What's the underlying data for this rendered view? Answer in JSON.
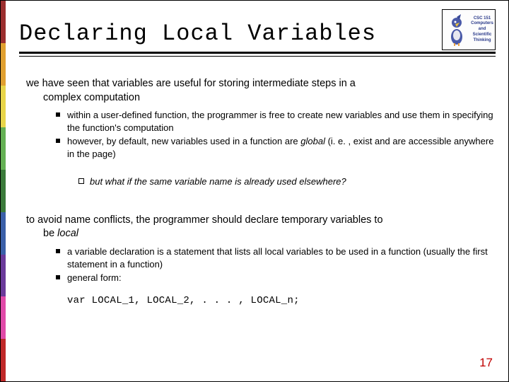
{
  "title": "Declaring Local Variables",
  "logo": {
    "course": "CSC 151",
    "line1": "Computers",
    "line2": "and",
    "line3": "Scientific",
    "line4": "Thinking"
  },
  "para1_a": "we have seen that variables are useful for storing intermediate steps in a",
  "para1_b": "complex computation",
  "bullets1": {
    "b1": "within a user-defined function, the programmer is free to create new variables and use them in specifying the function's computation",
    "b2_a": "however, by default, new variables used in a function are ",
    "b2_b": "global",
    "b2_c": " (i. e. , exist and are accessible anywhere in the page)"
  },
  "sub1": "but what if the same variable name is already used elsewhere?",
  "para2_a": "to avoid name conflicts, the programmer should declare temporary variables to",
  "para2_b": "be ",
  "para2_c": "local",
  "bullets2": {
    "b1": "a variable declaration is a statement that lists all local variables to be used in a function (usually the first statement in a function)",
    "b2": "general form:"
  },
  "code": "var LOCAL_1, LOCAL_2, . . . , LOCAL_n;",
  "colorbar": [
    "#9b2e2e",
    "#e0a030",
    "#e8d54a",
    "#64b054",
    "#3a7a3a",
    "#3a5fa8",
    "#6a3a9a",
    "#e04aa8",
    "#c02828"
  ],
  "page": "17"
}
